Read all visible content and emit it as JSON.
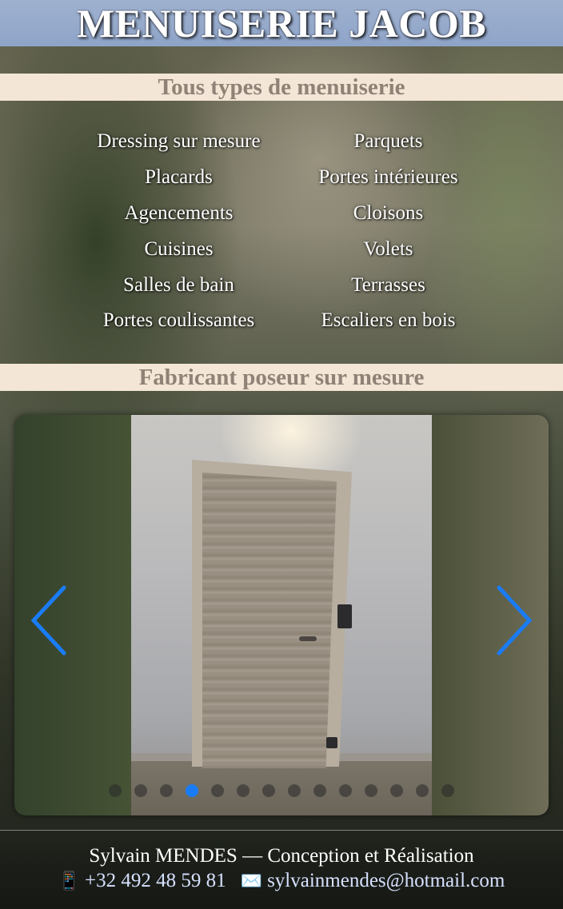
{
  "header": {
    "title": "MENUISERIE JACOB"
  },
  "section1": {
    "title": "Tous types de menuiserie"
  },
  "services": {
    "left": [
      "Dressing sur mesure",
      "Placards",
      "Agencements",
      "Cuisines",
      "Salles de bain",
      "Portes coulissantes"
    ],
    "right": [
      "Parquets",
      "Portes intérieures",
      "Cloisons",
      "Volets",
      "Terrasses",
      "Escaliers en bois"
    ]
  },
  "section2": {
    "title": "Fabricant poseur sur mesure"
  },
  "carousel": {
    "slide_count": 14,
    "active_index": 3,
    "prev_icon": "chevron-left-icon",
    "next_icon": "chevron-right-icon",
    "accent_color": "#1a7cf5"
  },
  "footer": {
    "credit": "Sylvain MENDES — Conception et Réalisation",
    "phone_icon": "📱",
    "phone": "+32 492 48 59 81",
    "email_icon": "✉️",
    "email": "sylvainmendes@hotmail.com"
  }
}
